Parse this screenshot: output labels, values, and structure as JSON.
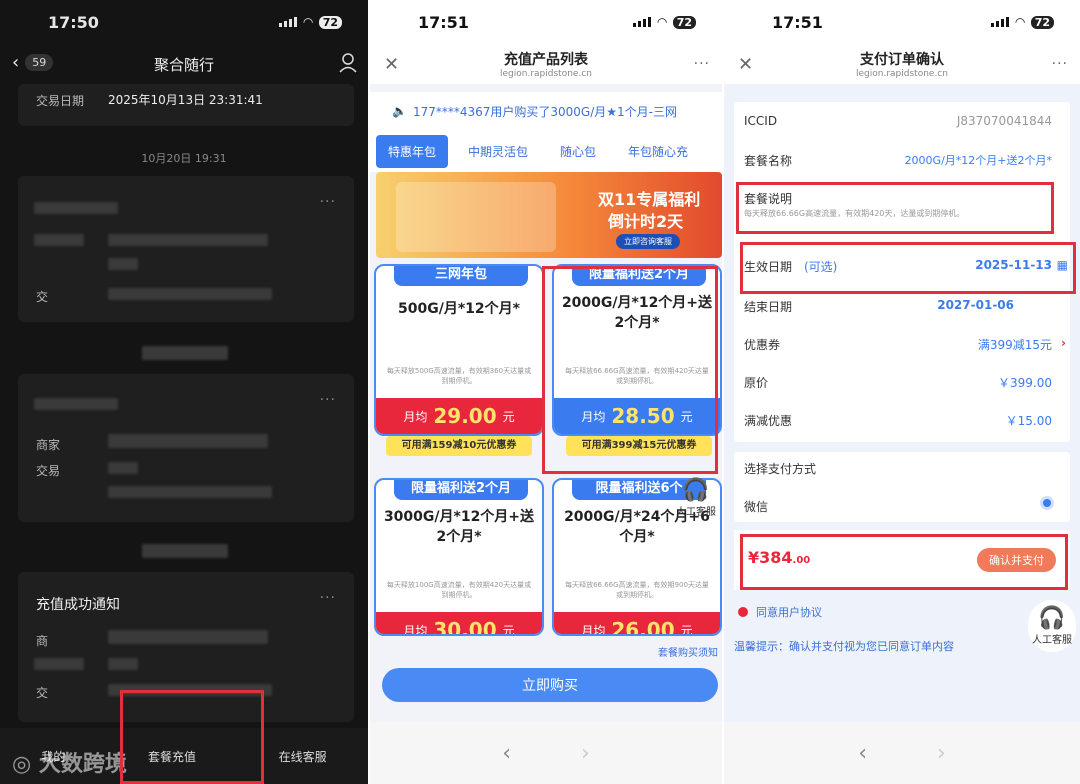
{
  "p1": {
    "time": "17:50",
    "battery": "72",
    "back_count": "59",
    "title": "聚合随行",
    "trade_label": "交易日期",
    "trade_value": "2025年10月13日 23:31:41",
    "date_sep": "10月20日 19:31",
    "card2_lbl": "交",
    "card3_lbl1": "商家",
    "card3_lbl2": "交易",
    "notice_title": "充值成功通知",
    "notice_lbl1": "商",
    "notice_lbl3": "交",
    "more": "···",
    "bottom": [
      "我的",
      "套餐充值",
      "在线客服"
    ],
    "watermark": "大数跨境"
  },
  "p2": {
    "time": "17:51",
    "battery": "72",
    "title": "充值产品列表",
    "subtitle": "legion.rapidstone.cn",
    "marquee": "177****4367用户购买了3000G/月★1个月-三网",
    "tabs": [
      "特惠年包",
      "中期灵活包",
      "随心包",
      "年包随心充"
    ],
    "banner": {
      "line1": "双11专属福利",
      "line2": "倒计时2天",
      "btn": "立即咨询客服"
    },
    "cards": [
      {
        "header": "三网年包",
        "name": "500G/月*12个月*",
        "desc": "每天释放500G高速流量，有效期360天达量或到期停机。",
        "price_label": "月均",
        "price": "29.00",
        "unit": "元",
        "coupon": "可用满159减10元优惠券"
      },
      {
        "header": "限量福利送2个月",
        "name": "2000G/月*12个月+送2个月*",
        "desc": "每天释放66.66G高速流量，有效期420天达量或到期停机。",
        "price_label": "月均",
        "price": "28.50",
        "unit": "元",
        "coupon": "可用满399减15元优惠券"
      },
      {
        "header": "限量福利送2个月",
        "name": "3000G/月*12个月+送2个月*",
        "desc": "每天释放100G高速流量，有效期420天达量或到期停机。",
        "price_label": "月均",
        "price": "30.00",
        "unit": "元"
      },
      {
        "header": "限量福利送6个",
        "name": "2000G/月*24个月+6个月*",
        "desc": "每天释放66.66G高速流量，有效期900天达量或到期停机。",
        "price_label": "月均",
        "price": "26.00",
        "unit": "元"
      }
    ],
    "notice": "套餐购买须知",
    "buy": "立即购买",
    "cs": "人工客服"
  },
  "p3": {
    "time": "17:51",
    "battery": "72",
    "title": "支付订单确认",
    "subtitle": "legion.rapidstone.cn",
    "iccid_k": "ICCID",
    "iccid_v": "J837070041844",
    "pkg_k": "套餐名称",
    "pkg_v": "2000G/月*12个月+送2个月*",
    "desc_k": "套餐说明",
    "desc_v": "每天释放66.66G高速流量，有效期420天，达量或到期停机。",
    "start_k": "生效日期",
    "start_opt": "(可选)",
    "start_v": "2025-11-13",
    "end_k": "结束日期",
    "end_v": "2027-01-06",
    "coupon_k": "优惠券",
    "coupon_v": "满399减15元",
    "price_k": "原价",
    "price_v": "￥399.00",
    "discount_k": "满减优惠",
    "discount_v": "￥15.00",
    "method_k": "选择支付方式",
    "wechat": "微信",
    "total_sym": "¥",
    "total": "384",
    "total_dec": ".00",
    "pay_btn": "确认并支付",
    "agree": "同意用户协议",
    "tip": "温馨提示：确认并支付视为您已同意订单内容",
    "cs": "人工客服"
  }
}
